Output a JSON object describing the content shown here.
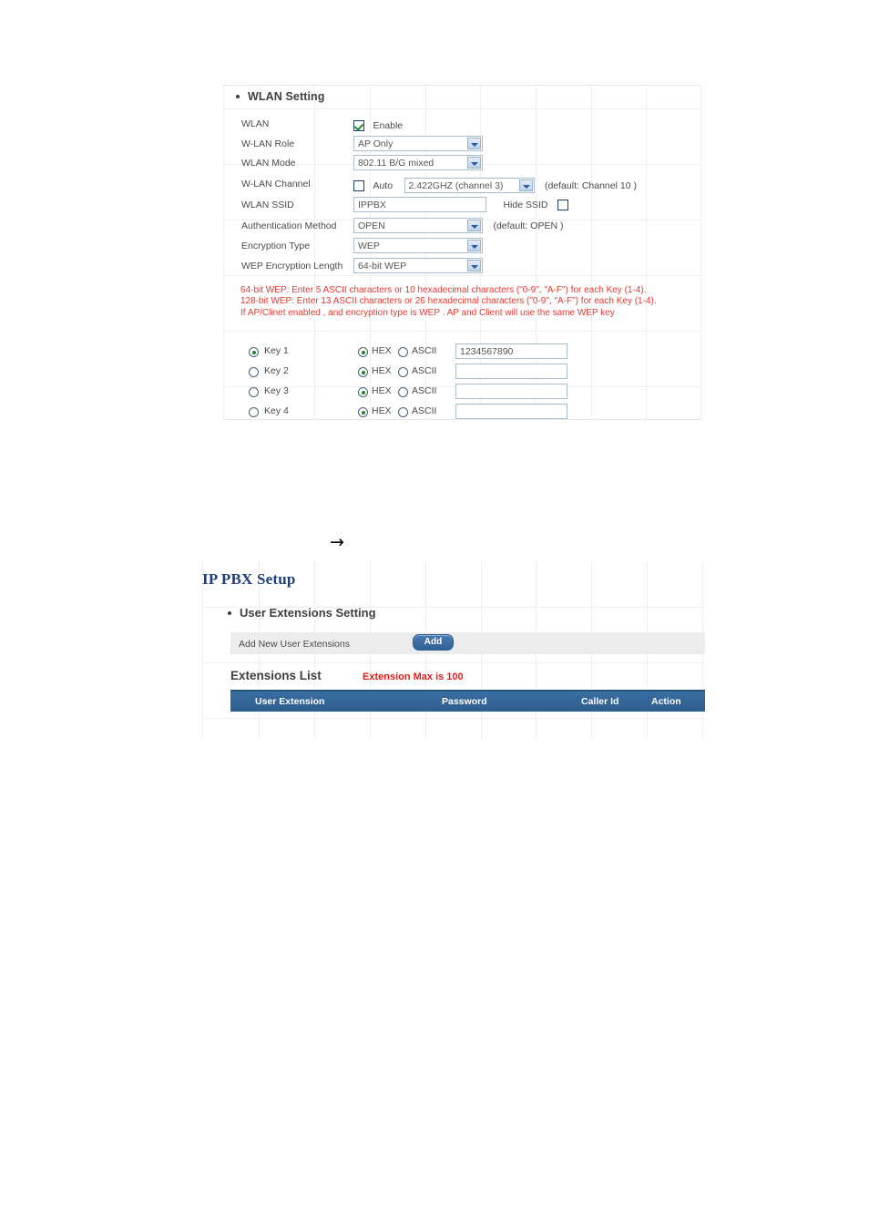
{
  "wlan": {
    "section_title": "WLAN Setting",
    "rows": {
      "wlan": {
        "label": "WLAN",
        "checkbox_label": "Enable",
        "checked": true
      },
      "role": {
        "label": "W-LAN Role",
        "value": "AP Only"
      },
      "mode": {
        "label": "WLAN Mode",
        "value": "802.11 B/G mixed"
      },
      "channel": {
        "label": "W-LAN Channel",
        "auto_label": "Auto",
        "auto_checked": false,
        "value": "2.422GHZ (channel 3)",
        "hint": "(default: Channel 10 )"
      },
      "ssid": {
        "label": "WLAN SSID",
        "value": "IPPBX",
        "hide_label": "Hide SSID",
        "hide_checked": false
      },
      "auth": {
        "label": "Authentication Method",
        "value": "OPEN",
        "hint": "(default: OPEN )"
      },
      "enc_type": {
        "label": "Encryption Type",
        "value": "WEP"
      },
      "wep_len": {
        "label": "WEP Encryption Length",
        "value": "64-bit WEP"
      }
    },
    "notes": [
      "64-bit WEP: Enter 5 ASCII characters or 10 hexadecimal characters (\"0-9\", \"A-F\") for each Key (1-4).",
      "128-bit WEP: Enter 13 ASCII characters or 26 hexadecimal characters (\"0-9\", \"A-F\") for each Key (1-4).",
      "If AP/Clinet enabled , and encryption type is WEP . AP and Client will use the same WEP key"
    ],
    "hex_label": "HEX",
    "ascii_label": "ASCII",
    "keys": [
      {
        "label": "Key 1",
        "selected": true,
        "format": "HEX",
        "value": "1234567890"
      },
      {
        "label": "Key 2",
        "selected": false,
        "format": "HEX",
        "value": ""
      },
      {
        "label": "Key 3",
        "selected": false,
        "format": "HEX",
        "value": ""
      },
      {
        "label": "Key 4",
        "selected": false,
        "format": "HEX",
        "value": ""
      }
    ]
  },
  "flow": {
    "arrow": "→"
  },
  "pbx": {
    "title": "IP PBX Setup",
    "section_title": "User Extensions Setting",
    "add_row_label": "Add New User Extensions",
    "add_button_label": "Add",
    "list_title": "Extensions List",
    "max_note": "Extension Max is 100",
    "columns": [
      "User Extension",
      "Password",
      "Caller Id",
      "Action"
    ],
    "rows": []
  },
  "colors": {
    "header_blue": "#2e5e90",
    "title_navy": "#1f3f73",
    "note_red": "#e03a33",
    "max_red": "#e31b17",
    "bar_gray": "#ececec"
  }
}
